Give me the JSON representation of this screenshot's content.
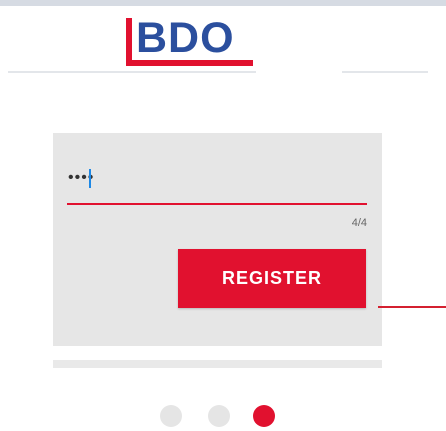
{
  "header": {
    "logo_text": "BDO"
  },
  "form": {
    "pin_value": "••••",
    "char_counter": "4/4",
    "register_label": "REGISTER"
  },
  "pager": {
    "total_pages": 3,
    "active_page": 3
  },
  "colors": {
    "brand_red": "#e1112f",
    "brand_blue": "#2b4f9e",
    "card_background": "#e6e6e6",
    "inactive_dot": "#e5e5e5"
  },
  "icons": {
    "logo": "bdo-logo"
  }
}
